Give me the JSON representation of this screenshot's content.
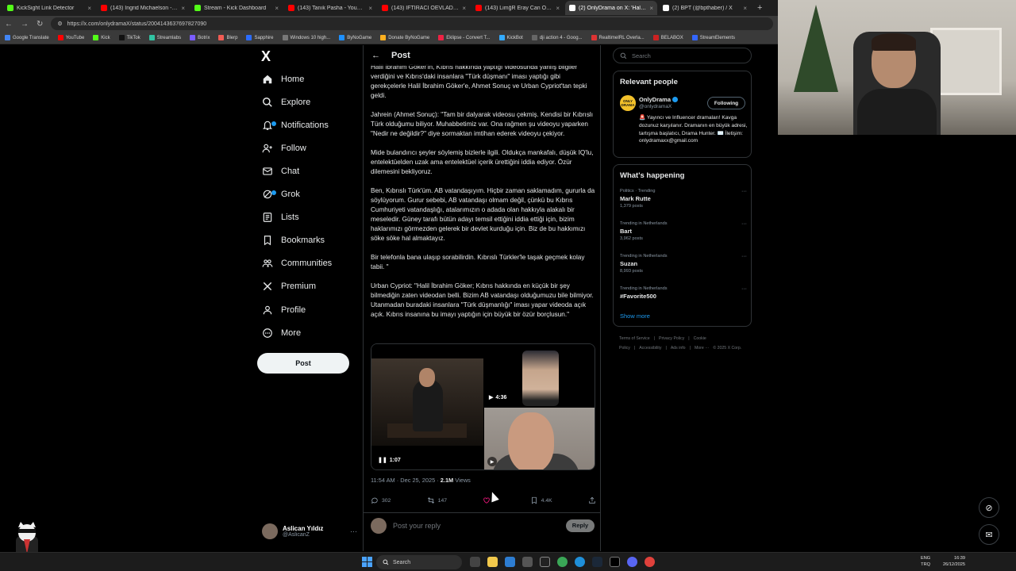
{
  "browser": {
    "tabs": [
      {
        "title": "KickSight Link Detector",
        "color": "#53fc18"
      },
      {
        "title": "(143) Ingrid Michaelson - Rockin'",
        "color": "#ff0000"
      },
      {
        "title": "Stream - Kick Dashboard",
        "color": "#53fc18"
      },
      {
        "title": "(143) Tanık Pasha - YouTube",
        "color": "#ff0000"
      },
      {
        "title": "(143) İFTİRACI OEVLADINIA CEVAP",
        "color": "#ff0000"
      },
      {
        "title": "(143) LimğR Eray Can Öztenar - 3",
        "color": "#ff0000"
      },
      {
        "title": "(2) OnlyDrama on X: 'Halil İb",
        "color": "#ffffff",
        "active": true
      },
      {
        "title": "(2) BPT (@bpthaber) / X",
        "color": "#ffffff"
      }
    ],
    "new_tab": "+",
    "back": "←",
    "forward": "→",
    "reload": "↻",
    "url": "https://x.com/onlydramaX/status/2004143637697827090",
    "bookmarks": [
      "Google Translate",
      "YouTube",
      "Kick",
      "TikTok",
      "Streamlabs",
      "Botrix",
      "Blerp",
      "Sapphire",
      "Windows 10 high...",
      "ByNoGame",
      "Donate ByNoGame",
      "Eklipse - Convert T...",
      "KickBot",
      "dji action 4 - Goog...",
      "RealtimeIRL Overla...",
      "BELABOX",
      "StreamElements"
    ]
  },
  "left_nav": {
    "logo": "X",
    "items": [
      {
        "label": "Home",
        "icon": "home-icon"
      },
      {
        "label": "Explore",
        "icon": "search-icon"
      },
      {
        "label": "Notifications",
        "icon": "bell-icon"
      },
      {
        "label": "Follow",
        "icon": "follow-icon"
      },
      {
        "label": "Chat",
        "icon": "mail-icon"
      },
      {
        "label": "Grok",
        "icon": "grok-icon"
      },
      {
        "label": "Lists",
        "icon": "list-icon"
      },
      {
        "label": "Bookmarks",
        "icon": "bookmark-icon"
      },
      {
        "label": "Communities",
        "icon": "communities-icon"
      },
      {
        "label": "Premium",
        "icon": "x-premium-icon"
      },
      {
        "label": "Profile",
        "icon": "person-icon"
      },
      {
        "label": "More",
        "icon": "more-circle-icon"
      }
    ],
    "post_button": "Post",
    "account": {
      "name": "Aslican Yıldız",
      "handle": "@AslicanZ",
      "menu": "···"
    }
  },
  "main": {
    "header": {
      "back": "←",
      "title": "Post"
    },
    "paragraphs": [
      "Halil İbrahim Göker'in, Kıbrıs hakkında yaptığı videosunda yanlış bilgiler verdiğini ve Kıbrıs'daki insanlara \"Türk düşmanı\" iması yaptığı gibi gerekçelerle Halil İbrahim Göker'e, Ahmet Sonuç ve Urban Cypriot'tan tepki geldi.",
      "Jahrein (Ahmet Sonuç): \"Tam bir dalyarak videosu çekmiş. Kendisi bir Kıbrıslı Türk olduğumu biliyor. Muhabbetimiz var. Ona rağmen şu videoyu yaparken \"Nedir ne değildir?\" diye sormaktan imtihan ederek videoyu çekiyor.",
      "Mide bulandırıcı şeyler söylemiş bizlerle ilgili. Oldukça mankafalı, düşük IQ'lu, entelektüelden uzak ama entelektüel içerik ürettiğini iddia ediyor. Özür dilemesini bekliyoruz.",
      "Ben, Kıbrıslı Türk'üm. AB vatandaşıyım. Hiçbir zaman saklamadım, gururla da söylüyorum. Gurur sebebi, AB vatandaşı olmam değil, çünkü bu Kıbrıs Cumhuriyeti vatandaşlığı, atalarımızın o adada olan hakkıyla alakalı bir meseledir. Güney tarafı bütün adayı temsil ettiğini iddia ettiği için, bizim haklarımızı görmezden gelerek bir devlet kurduğu için. Biz de bu hakkımızı söke söke hal almaktayız.",
      "Bir telefonla bana ulaşıp sorabilirdin. Kıbrıslı Türkler'le taşak geçmek kolay tabii. \"",
      "Urban Cypriot: \"Halil İbrahim Göker; Kıbrıs hakkında en küçük bir şey bilmediğin zaten videodan belli. Bizim AB vatandaşı olduğumuzu bile bilmiyor. Utanmadan buradaki insanlara \"Türk düşmanlığı\" iması yapar videoda açık açık. Kıbrıs insanına bu imayı yaptığın için büyük bir özür borçlusun.\""
    ],
    "media": {
      "video1_duration": "1:07",
      "video2_duration": "4:36"
    },
    "meta": {
      "time": "11:54 AM · Dec 25, 2025 · ",
      "views_count": "2.1M",
      "views_label": " Views"
    },
    "actions": {
      "replies": "302",
      "reposts": "147",
      "likes": "",
      "bookmarks": "4.4K"
    },
    "reply": {
      "placeholder": "Post your reply",
      "button": "Reply"
    }
  },
  "right": {
    "search_placeholder": "Search",
    "relevant": {
      "title": "Relevant people",
      "avatar_text": "ONLY DRAMA",
      "name": "OnlyDrama",
      "handle": "@onlydramaX",
      "follow": "Following",
      "bio": "🚨 Yayıncı ve Influencer dramaları! Kavga dozunuz karşılanır. Dramanın en büyük adresi, tartışma başlatıcı, Drama Hunter. ✉️ İletişim: onlydramaxx@gmail.com"
    },
    "happening": {
      "title": "What's happening",
      "trends": [
        {
          "context": "Politics · Trending",
          "title": "Mark Rutte",
          "count": "1,379 posts"
        },
        {
          "context": "Trending in Netherlands",
          "title": "Bart",
          "count": "3,962 posts"
        },
        {
          "context": "Trending in Netherlands",
          "title": "Suzan",
          "count": "8,993 posts"
        },
        {
          "context": "Trending in Netherlands",
          "title": "#Favorite500",
          "count": ""
        }
      ],
      "show_more": "Show more"
    },
    "footer": [
      "Terms of Service",
      "|",
      "Privacy Policy",
      "|",
      "Cookie Policy",
      "|",
      "Accessibility",
      "|",
      "Ads info",
      "|",
      "More ···",
      "© 2025 X Corp."
    ]
  },
  "taskbar": {
    "search": "Search",
    "lang": "ENG",
    "lang2": "TRQ",
    "time": "16:39",
    "date": "26/12/2025"
  }
}
